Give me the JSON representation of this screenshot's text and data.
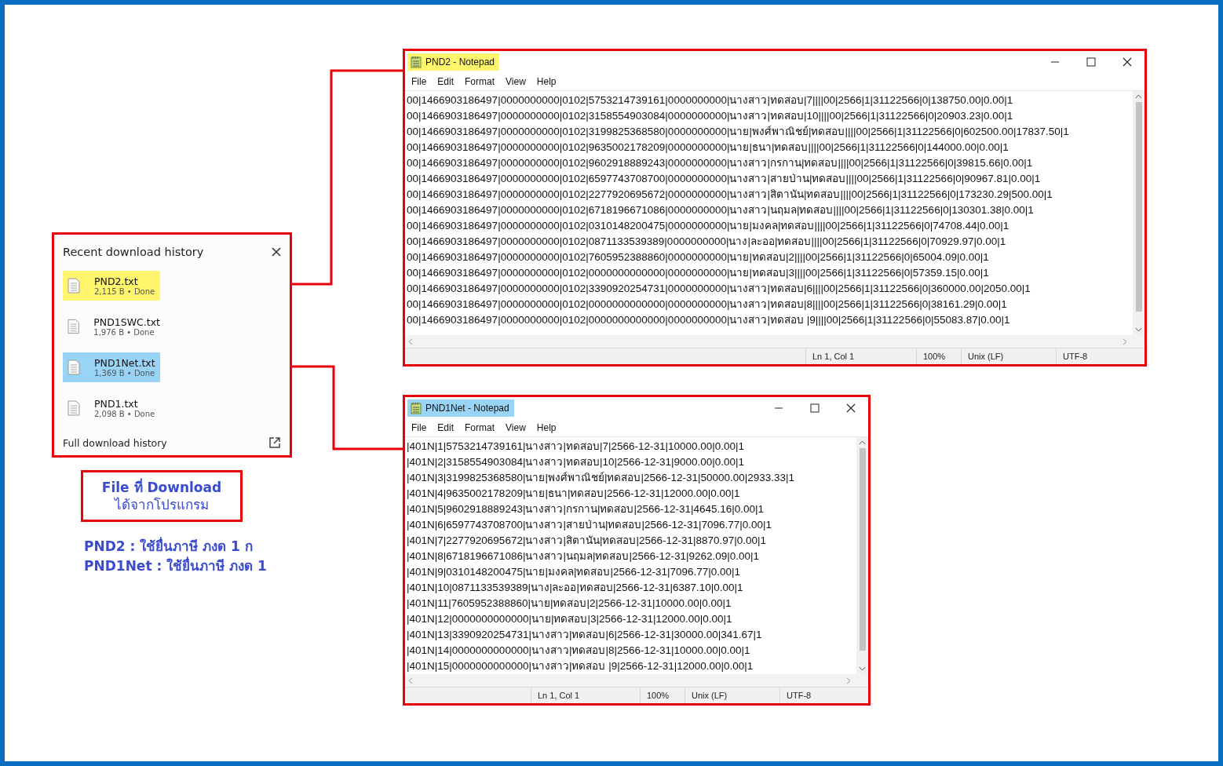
{
  "downloads": {
    "title": "Recent download history",
    "items": [
      {
        "name": "PND2.txt",
        "meta": "2,115 B • Done",
        "color": "#fff66e"
      },
      {
        "name": "PND1SWC.txt",
        "meta": "1,976 B • Done"
      },
      {
        "name": "PND1Net.txt",
        "meta": "1,369 B • Done",
        "color": "#99d3f5"
      },
      {
        "name": "PND1.txt",
        "meta": "2,098 B • Done"
      }
    ],
    "footer": "Full download history"
  },
  "caption": [
    "File ที่ Download",
    "ได้จากโปรแกรม"
  ],
  "legend": [
    "PND2 : ใช้ยื่นภาษี ภงด 1 ก",
    "PND1Net : ใช้ยื่นภาษี ภงด 1"
  ],
  "notepads": [
    {
      "title": "PND2 - Notepad",
      "color": "#fff66e",
      "menu": [
        "File",
        "Edit",
        "Format",
        "View",
        "Help"
      ],
      "lines": [
        "00|1466903186497|0000000000|0102|5753214739161|0000000000|นางสาว|ทดสอบ|7||||00|2566|1|31122566|0|138750.00|0.00|1",
        "00|1466903186497|0000000000|0102|3158554903084|0000000000|นางสาว|ทดสอบ|10||||00|2566|1|31122566|0|20903.23|0.00|1",
        "00|1466903186497|0000000000|0102|3199825368580|0000000000|นาย|พงศ์พาณิชย์|ทดสอบ||||00|2566|1|31122566|0|602500.00|17837.50|1",
        "00|1466903186497|0000000000|0102|9635002178209|0000000000|นาย|ธนา|ทดสอบ||||00|2566|1|31122566|0|144000.00|0.00|1",
        "00|1466903186497|0000000000|0102|9602918889243|0000000000|นางสาว|กรกาน|ทดสอบ||||00|2566|1|31122566|0|39815.66|0.00|1",
        "00|1466903186497|0000000000|0102|6597743708700|0000000000|นางสาว|สายป่าน|ทดสอบ||||00|2566|1|31122566|0|90967.81|0.00|1",
        "00|1466903186497|0000000000|0102|2277920695672|0000000000|นางสาว|สิตานัน|ทดสอบ||||00|2566|1|31122566|0|173230.29|500.00|1",
        "00|1466903186497|0000000000|0102|6718196671086|0000000000|นางสาว|นฤมล|ทดสอบ||||00|2566|1|31122566|0|130301.38|0.00|1",
        "00|1466903186497|0000000000|0102|0310148200475|0000000000|นาย|มงคล|ทดสอบ||||00|2566|1|31122566|0|74708.44|0.00|1",
        "00|1466903186497|0000000000|0102|0871133539389|0000000000|นาง|ละออ|ทดสอบ||||00|2566|1|31122566|0|70929.97|0.00|1",
        "00|1466903186497|0000000000|0102|7605952388860|0000000000|นาย|ทดสอบ|2||||00|2566|1|31122566|0|65004.09|0.00|1",
        "00|1466903186497|0000000000|0102|0000000000000|0000000000|นาย|ทดสอบ|3||||00|2566|1|31122566|0|57359.15|0.00|1",
        "00|1466903186497|0000000000|0102|3390920254731|0000000000|นางสาว|ทดสอบ|6||||00|2566|1|31122566|0|360000.00|2050.00|1",
        "00|1466903186497|0000000000|0102|0000000000000|0000000000|นางสาว|ทดสอบ|8||||00|2566|1|31122566|0|38161.29|0.00|1",
        "00|1466903186497|0000000000|0102|0000000000000|0000000000|นางสาว|ทดสอบ |9||||00|2566|1|31122566|0|55083.87|0.00|1"
      ],
      "status": {
        "position": "Ln 1, Col 1",
        "zoom": "100%",
        "line_ending": "Unix (LF)",
        "encoding": "UTF-8"
      }
    },
    {
      "title": "PND1Net - Notepad",
      "color": "#99d3f5",
      "menu": [
        "File",
        "Edit",
        "Format",
        "View",
        "Help"
      ],
      "lines": [
        "|401N|1|5753214739161|นางสาว|ทดสอบ|7|2566-12-31|10000.00|0.00|1",
        "|401N|2|3158554903084|นางสาว|ทดสอบ|10|2566-12-31|9000.00|0.00|1",
        "|401N|3|3199825368580|นาย|พงศ์พาณิชย์|ทดสอบ|2566-12-31|50000.00|2933.33|1",
        "|401N|4|9635002178209|นาย|ธนา|ทดสอบ|2566-12-31|12000.00|0.00|1",
        "|401N|5|9602918889243|นางสาว|กรกาน|ทดสอบ|2566-12-31|4645.16|0.00|1",
        "|401N|6|6597743708700|นางสาว|สายป่าน|ทดสอบ|2566-12-31|7096.77|0.00|1",
        "|401N|7|2277920695672|นางสาว|สิตานัน|ทดสอบ|2566-12-31|8870.97|0.00|1",
        "|401N|8|6718196671086|นางสาว|นฤมล|ทดสอบ|2566-12-31|9262.09|0.00|1",
        "|401N|9|0310148200475|นาย|มงคล|ทดสอบ|2566-12-31|7096.77|0.00|1",
        "|401N|10|0871133539389|นาง|ละออ|ทดสอบ|2566-12-31|6387.10|0.00|1",
        "|401N|11|7605952388860|นาย|ทดสอบ|2|2566-12-31|10000.00|0.00|1",
        "|401N|12|0000000000000|นาย|ทดสอบ|3|2566-12-31|12000.00|0.00|1",
        "|401N|13|3390920254731|นางสาว|ทดสอบ|6|2566-12-31|30000.00|341.67|1",
        "|401N|14|0000000000000|นางสาว|ทดสอบ|8|2566-12-31|10000.00|0.00|1",
        "|401N|15|0000000000000|นางสาว|ทดสอบ |9|2566-12-31|12000.00|0.00|1"
      ],
      "status": {
        "position": "Ln 1, Col 1",
        "zoom": "100%",
        "line_ending": "Unix (LF)",
        "encoding": "UTF-8"
      }
    }
  ]
}
